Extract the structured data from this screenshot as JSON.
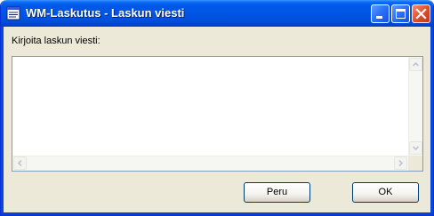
{
  "window": {
    "title": "WM-Laskutus - Laskun viesti",
    "app_icon": "document-list-icon",
    "buttons": {
      "minimize": "minimize-icon",
      "maximize": "maximize-icon",
      "close": "close-icon"
    }
  },
  "form": {
    "label": "Kirjoita laskun viesti:",
    "message_value": ""
  },
  "actions": {
    "cancel_label": "Peru",
    "ok_label": "OK"
  },
  "colors": {
    "titlebar": "#0055e5",
    "window_bg": "#ece9d8",
    "close_button": "#e0502a"
  }
}
